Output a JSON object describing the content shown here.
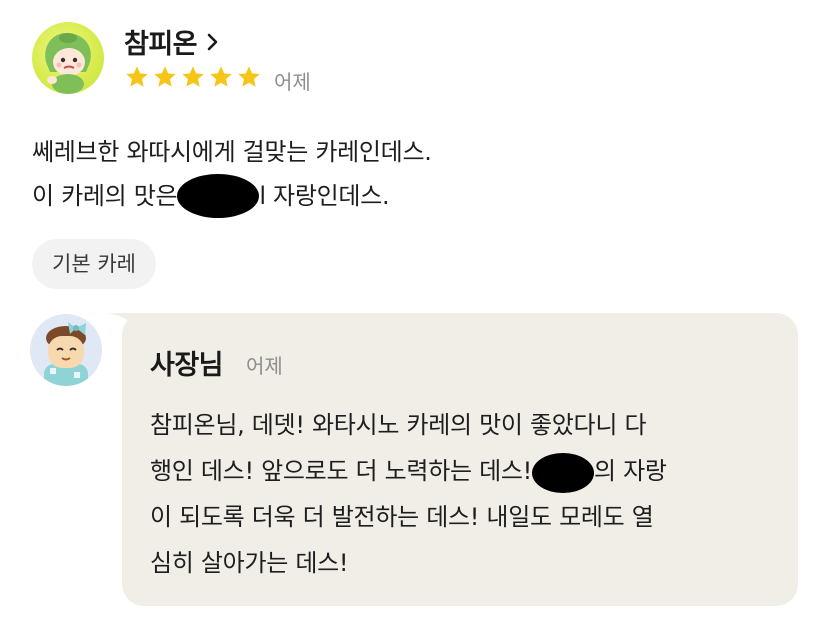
{
  "review": {
    "reviewer_name": "참피온",
    "rating": 5,
    "date": "어제",
    "lines": [
      {
        "before": "쎄레브한 와따시에게 걸맞는 카레인데스.",
        "after": ""
      },
      {
        "before": "이 카레의 맛은",
        "after": "l 자랑인데스."
      }
    ],
    "option_chip": "기본 카레"
  },
  "reply": {
    "owner_name": "사장님",
    "date": "어제",
    "lines": [
      {
        "before": "참피온님, 데뎃! 와타시노 카레의 맛이 좋았다니 다",
        "after": ""
      },
      {
        "before": "행인 데스! 앞으로도 더 노력하는 데스!",
        "after": "의 자랑"
      },
      {
        "before": "이 되도록 더욱 더 발전하는 데스! 내일도 모레도 열",
        "after": ""
      },
      {
        "before": "심히 살아가는 데스!",
        "after": ""
      }
    ]
  },
  "colors": {
    "star": "#f5c518",
    "reply_background": "#f1eee8",
    "chip_background": "#f2f2f2",
    "muted_text": "#8e8e8e"
  },
  "icons": {
    "chevron": "chevron-right-icon",
    "star": "star-icon"
  }
}
